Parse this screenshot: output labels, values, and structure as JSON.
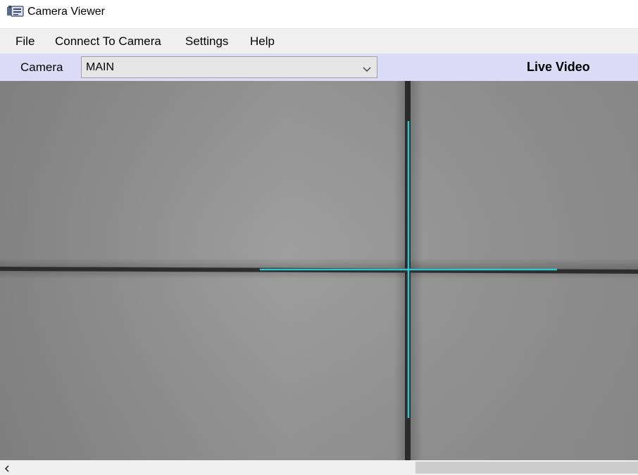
{
  "window": {
    "title": "Camera Viewer",
    "icon": "video-camera-icon"
  },
  "menubar": {
    "items": [
      {
        "label": "File"
      },
      {
        "label": "Connect To Camera"
      },
      {
        "label": "Settings"
      },
      {
        "label": "Help"
      }
    ]
  },
  "toolbar": {
    "camera_label": "Camera",
    "camera_select_value": "MAIN",
    "status_label": "Live Video"
  },
  "video": {
    "crosshair_color": "#2ec4d0"
  },
  "scrollbar": {
    "left_arrow": "<"
  }
}
